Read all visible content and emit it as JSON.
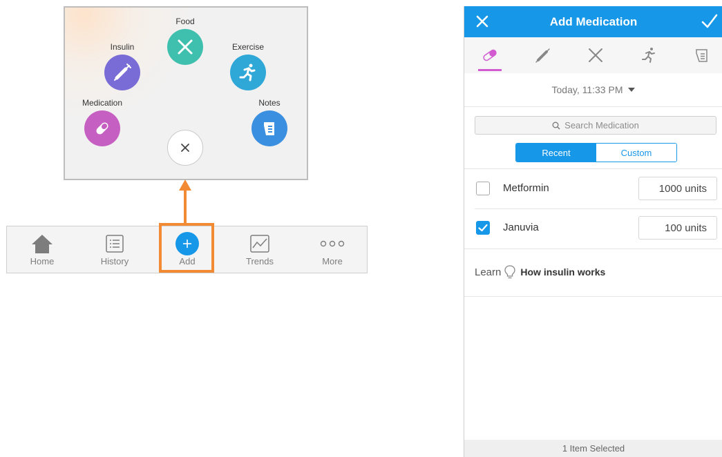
{
  "add_menu": {
    "items": [
      {
        "label": "Food",
        "icon": "fork-knife-icon",
        "color": "#3fbfae"
      },
      {
        "label": "Insulin",
        "icon": "syringe-icon",
        "color": "#7a6cd6"
      },
      {
        "label": "Exercise",
        "icon": "running-icon",
        "color": "#2fa8d8"
      },
      {
        "label": "Medication",
        "icon": "pill-icon",
        "color": "#c65fc2"
      },
      {
        "label": "Notes",
        "icon": "notes-icon",
        "color": "#3a8fe0"
      }
    ],
    "close_icon": "close-icon"
  },
  "tabbar": {
    "tabs": [
      {
        "label": "Home",
        "icon": "home-icon"
      },
      {
        "label": "History",
        "icon": "list-icon"
      },
      {
        "label": "Add",
        "icon": "plus-icon",
        "selected": true
      },
      {
        "label": "Trends",
        "icon": "chart-icon"
      },
      {
        "label": "More",
        "icon": "more-icon"
      }
    ],
    "highlight_color": "#f28a34"
  },
  "add_medication": {
    "title": "Add Medication",
    "accent": "#1797e8",
    "entry_types": [
      "pill-icon",
      "syringe-icon",
      "fork-knife-icon",
      "running-icon",
      "notes-icon"
    ],
    "date_label": "Today, 11:33 PM",
    "search_placeholder": "Search Medication",
    "segments": [
      "Recent",
      "Custom"
    ],
    "selected_segment": "Recent",
    "medications": [
      {
        "name": "Metformin",
        "dose": "1000 units",
        "checked": false
      },
      {
        "name": "Januvia",
        "dose": "100 units",
        "checked": true
      }
    ],
    "learn_label": "Learn",
    "learn_topic": "How insulin works",
    "footer": "1 Item Selected"
  }
}
